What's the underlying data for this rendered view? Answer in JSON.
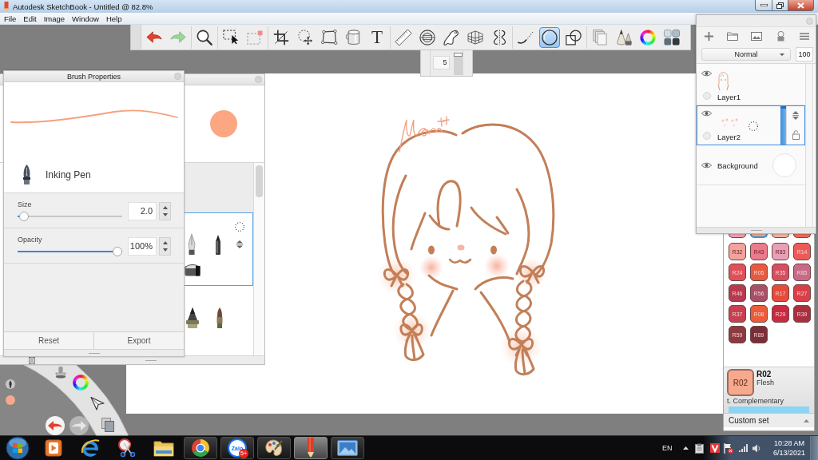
{
  "window": {
    "title": "Autodesk SketchBook - Untitled @ 82.8%"
  },
  "menu": [
    "File",
    "Edit",
    "Image",
    "Window",
    "Help"
  ],
  "toolbar": {
    "groups": [
      {
        "tools": [
          {
            "kind": "undo",
            "selected": false
          },
          {
            "kind": "redo",
            "selected": false
          }
        ]
      },
      {
        "tools": [
          {
            "kind": "zoom",
            "selected": false
          }
        ]
      },
      {
        "tools": [
          {
            "kind": "select",
            "selected": false
          },
          {
            "kind": "deselect",
            "selected": false
          }
        ]
      },
      {
        "tools": [
          {
            "kind": "crop",
            "selected": false
          },
          {
            "kind": "transform",
            "selected": false
          },
          {
            "kind": "distort",
            "selected": false
          },
          {
            "kind": "fill",
            "selected": false
          },
          {
            "kind": "text",
            "label": "T",
            "selected": false
          }
        ]
      },
      {
        "tools": [
          {
            "kind": "ruler",
            "selected": false
          },
          {
            "kind": "ellipse_guide",
            "selected": false
          },
          {
            "kind": "french_curve",
            "selected": false
          },
          {
            "kind": "perspective",
            "selected": false
          },
          {
            "kind": "symmetry",
            "selected": false
          }
        ]
      },
      {
        "tools": [
          {
            "kind": "line",
            "selected": false
          },
          {
            "kind": "ellipse",
            "selected": true
          },
          {
            "kind": "shapes",
            "selected": false
          }
        ]
      },
      {
        "tools": [
          {
            "kind": "copy",
            "selected": false
          },
          {
            "kind": "brushes",
            "selected": false
          },
          {
            "kind": "color_wheel",
            "selected": false
          },
          {
            "kind": "copic",
            "selected": false
          }
        ]
      }
    ]
  },
  "size_popup": {
    "value": "5",
    "level": 1
  },
  "brush_properties": {
    "title": "Brush Properties",
    "brush_name": "Inking Pen",
    "sliders": [
      {
        "label": "Size",
        "value": "2.0",
        "level": 0.02
      },
      {
        "label": "Opacity",
        "value": "100%",
        "level": 1
      }
    ],
    "buttons": [
      "Reset",
      "Export"
    ]
  },
  "copic": {
    "partial_row": [
      {
        "color": "#eaa2b2",
        "selected": false
      },
      {
        "color": "#f2a486",
        "selected": true
      },
      {
        "color": "#f0b4a4",
        "selected": false
      },
      {
        "color": "#ec6c5c",
        "selected": false
      }
    ],
    "swatches": [
      {
        "code": "R32",
        "color": "#f2a39c",
        "selected": false
      },
      {
        "code": "R43",
        "color": "#ec7a8c",
        "selected": false
      },
      {
        "code": "R83",
        "color": "#e8a0b8",
        "selected": false
      },
      {
        "code": "R14",
        "color": "#ee5a58",
        "selected": false
      },
      {
        "code": "R24",
        "color": "#e05058",
        "selected": false
      },
      {
        "code": "R05",
        "color": "#e85a40",
        "selected": false
      },
      {
        "code": "R35",
        "color": "#d84e60",
        "selected": false
      },
      {
        "code": "R85",
        "color": "#c86a88",
        "selected": false
      },
      {
        "code": "R46",
        "color": "#b83a4e",
        "selected": false
      },
      {
        "code": "R56",
        "color": "#a85068",
        "selected": false
      },
      {
        "code": "R17",
        "color": "#e84a3a",
        "selected": false
      },
      {
        "code": "R27",
        "color": "#d84048",
        "selected": false
      },
      {
        "code": "R37",
        "color": "#c84050",
        "selected": false
      },
      {
        "code": "R08",
        "color": "#ec5c38",
        "selected": false
      },
      {
        "code": "R29",
        "color": "#c82a40",
        "selected": false
      },
      {
        "code": "R39",
        "color": "#a8303e",
        "selected": false
      },
      {
        "code": "R59",
        "color": "#8c3a40",
        "selected": false
      },
      {
        "code": "R89",
        "color": "#7a2e38",
        "selected": false
      }
    ],
    "current": {
      "swatch_label": "R02",
      "code": "R02",
      "name": "Flesh"
    },
    "complementary": "t. Complementary",
    "set_name": "Custom set"
  },
  "layers": {
    "blend_mode": "Normal",
    "opacity": "100",
    "items": [
      {
        "kind": "layer",
        "name": "Layer1",
        "visible": true,
        "selected": false
      },
      {
        "kind": "layer",
        "name": "Layer2",
        "visible": true,
        "selected": true
      },
      {
        "kind": "background",
        "name": "Background",
        "visible": true,
        "selected": false
      }
    ]
  },
  "taskbar": {
    "apps": [
      {
        "kind": "media",
        "running": false,
        "selected": false
      },
      {
        "kind": "web_e",
        "running": false,
        "selected": false
      },
      {
        "kind": "snipping",
        "running": false,
        "selected": false
      },
      {
        "kind": "folder",
        "running": false,
        "selected": false
      },
      {
        "kind": "round_logo",
        "running": true,
        "selected": false
      },
      {
        "kind": "messenger",
        "logo": "Zalo",
        "badge": "5+",
        "running": true,
        "selected": false
      },
      {
        "kind": "paint",
        "running": true,
        "selected": false
      },
      {
        "kind": "sketch",
        "running": true,
        "selected": true
      },
      {
        "kind": "photos",
        "running": true,
        "selected": false
      }
    ],
    "language": "EN",
    "time": "10:28 AM",
    "date": "6/13/2021"
  }
}
